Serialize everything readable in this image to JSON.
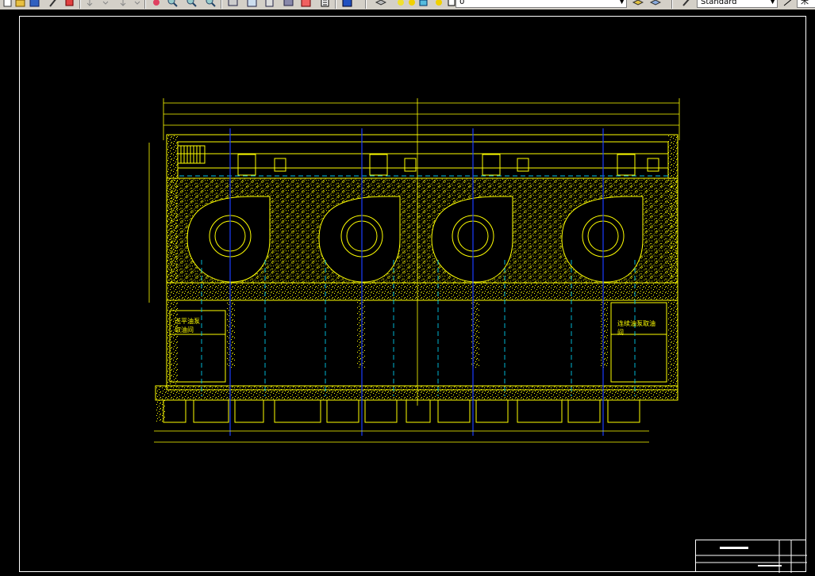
{
  "toolbar": {
    "text_style": "Standard",
    "layer_value": "0",
    "side_label": "米"
  },
  "drawing": {
    "room_left_line1": "送平油泵",
    "room_left_line2": "取油间",
    "room_right_line1": "连续油泵取油",
    "room_right_line2": "间"
  },
  "colors": {
    "background": "#000000",
    "lines": "#ffff00",
    "centerlines": "#00c8e8",
    "axes": "#1a3cff",
    "border": "#ffffff"
  }
}
